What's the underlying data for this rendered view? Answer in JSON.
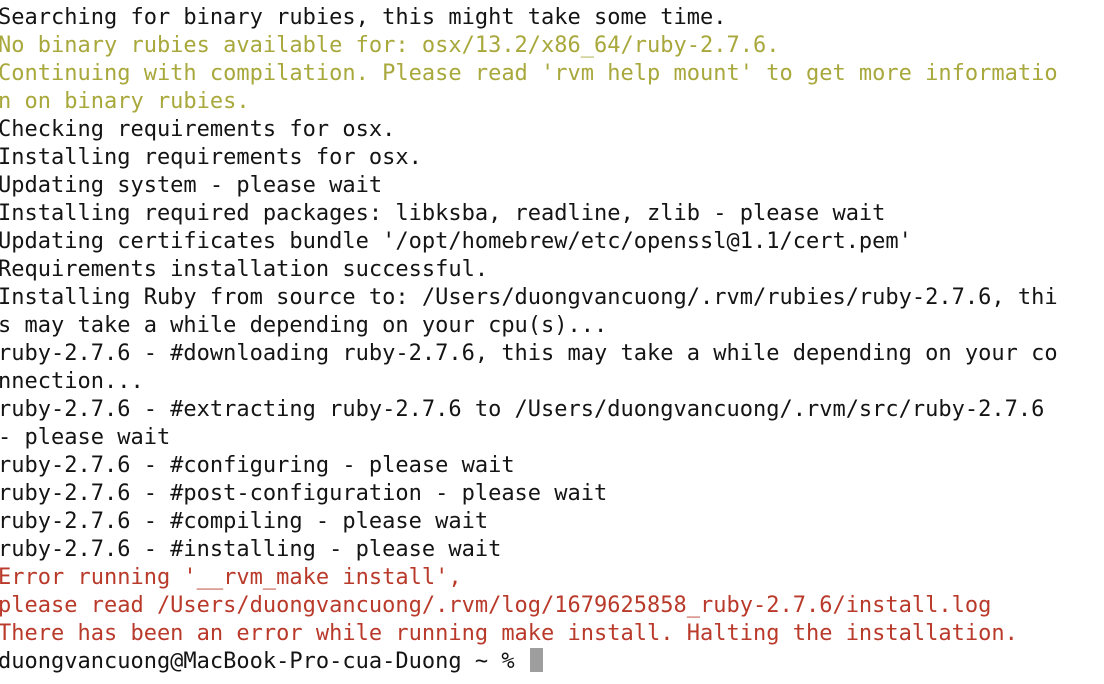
{
  "theme": {
    "background": "#ffffff",
    "text_normal": "#141414",
    "text_warning": "#a8a83c",
    "text_error": "#b93a2a",
    "cursor": "#9e9e9e"
  },
  "terminal": {
    "lines": [
      {
        "type": "normal",
        "text": "Searching for binary rubies, this might take some time."
      },
      {
        "type": "warning",
        "text": "No binary rubies available for: osx/13.2/x86_64/ruby-2.7.6."
      },
      {
        "type": "warning",
        "text": "Continuing with compilation. Please read 'rvm help mount' to get more informatio"
      },
      {
        "type": "warning",
        "text": "n on binary rubies."
      },
      {
        "type": "normal",
        "text": "Checking requirements for osx."
      },
      {
        "type": "normal",
        "text": "Installing requirements for osx."
      },
      {
        "type": "normal",
        "text": "Updating system - please wait"
      },
      {
        "type": "normal",
        "text": "Installing required packages: libksba, readline, zlib - please wait"
      },
      {
        "type": "normal",
        "text": "Updating certificates bundle '/opt/homebrew/etc/openssl@1.1/cert.pem'"
      },
      {
        "type": "normal",
        "text": "Requirements installation successful."
      },
      {
        "type": "normal",
        "text": "Installing Ruby from source to: /Users/duongvancuong/.rvm/rubies/ruby-2.7.6, thi"
      },
      {
        "type": "normal",
        "text": "s may take a while depending on your cpu(s)..."
      },
      {
        "type": "normal",
        "text": "ruby-2.7.6 - #downloading ruby-2.7.6, this may take a while depending on your co"
      },
      {
        "type": "normal",
        "text": "nnection..."
      },
      {
        "type": "normal",
        "text": "ruby-2.7.6 - #extracting ruby-2.7.6 to /Users/duongvancuong/.rvm/src/ruby-2.7.6 "
      },
      {
        "type": "normal",
        "text": "- please wait"
      },
      {
        "type": "normal",
        "text": "ruby-2.7.6 - #configuring - please wait"
      },
      {
        "type": "normal",
        "text": "ruby-2.7.6 - #post-configuration - please wait"
      },
      {
        "type": "normal",
        "text": "ruby-2.7.6 - #compiling - please wait"
      },
      {
        "type": "normal",
        "text": "ruby-2.7.6 - #installing - please wait"
      },
      {
        "type": "error",
        "text": "Error running '__rvm_make install',"
      },
      {
        "type": "error",
        "text": "please read /Users/duongvancuong/.rvm/log/1679625858_ruby-2.7.6/install.log"
      },
      {
        "type": "error",
        "text": "There has been an error while running make install. Halting the installation."
      }
    ],
    "prompt": "duongvancuong@MacBook-Pro-cua-Duong ~ % "
  }
}
